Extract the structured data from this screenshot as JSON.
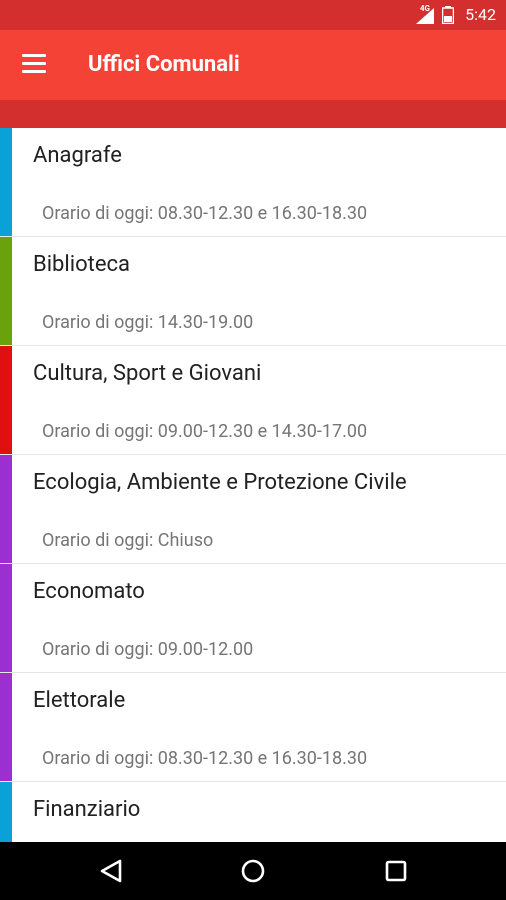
{
  "status_bar": {
    "network": "4G",
    "time": "5:42"
  },
  "app_bar": {
    "title": "Uffici Comunali",
    "menu_icon": "hamburger-menu-icon"
  },
  "offices": [
    {
      "name": "Anagrafe",
      "hours": "Orario di oggi: 08.30-12.30 e 16.30-18.30",
      "color": "#0aa0d8"
    },
    {
      "name": "Biblioteca",
      "hours": "Orario di oggi: 14.30-19.00",
      "color": "#6aa20d"
    },
    {
      "name": "Cultura, Sport e Giovani",
      "hours": "Orario di oggi: 09.00-12.30 e 14.30-17.00",
      "color": "#e01010"
    },
    {
      "name": "Ecologia, Ambiente e Protezione Civile",
      "hours": "Orario di oggi: Chiuso",
      "color": "#9b2fd0"
    },
    {
      "name": "Economato",
      "hours": "Orario di oggi: 09.00-12.00",
      "color": "#9b2fd0"
    },
    {
      "name": "Elettorale",
      "hours": "Orario di oggi: 08.30-12.30 e 16.30-18.30",
      "color": "#9b2fd0"
    },
    {
      "name": "Finanziario",
      "hours": "",
      "color": "#0aa0d8"
    }
  ],
  "nav_bar": {
    "back_icon": "back-triangle-icon",
    "home_icon": "home-circle-icon",
    "recent_icon": "recent-apps-square-icon"
  },
  "colors": {
    "status_bar": "#d32f2f",
    "app_bar": "#f44336",
    "nav_bar": "#000000"
  }
}
